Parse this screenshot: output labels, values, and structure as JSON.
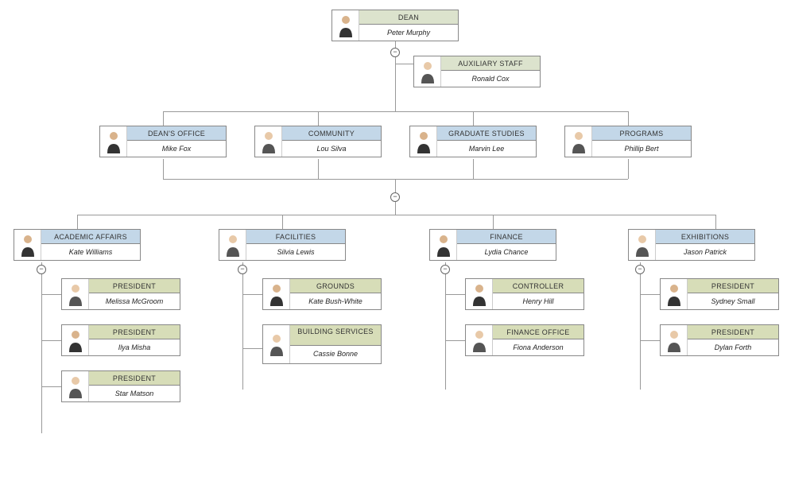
{
  "org": {
    "dean": {
      "title": "DEAN",
      "name": "Peter Murphy"
    },
    "aux": {
      "title": "AUXILIARY STAFF",
      "name": "Ronald Cox"
    },
    "deans_office": {
      "title": "DEAN'S OFFICE",
      "name": "Mike Fox"
    },
    "community": {
      "title": "COMMUNITY",
      "name": "Lou Silva"
    },
    "grad_studies": {
      "title": "GRADUATE STUDIES",
      "name": "Marvin Lee"
    },
    "programs": {
      "title": "PROGRAMS",
      "name": "Phillip Bert"
    },
    "academic": {
      "title": "ACADEMIC AFFAIRS",
      "name": "Kate Williams"
    },
    "facilities": {
      "title": "FACILITIES",
      "name": "Silvia Lewis"
    },
    "finance": {
      "title": "FINANCE",
      "name": "Lydia Chance"
    },
    "exhibitions": {
      "title": "EXHIBITIONS",
      "name": "Jason Patrick"
    },
    "president1": {
      "title": "PRESIDENT",
      "name": "Melissa McGroom"
    },
    "president2": {
      "title": "PRESIDENT",
      "name": "Ilya Misha"
    },
    "president3": {
      "title": "PRESIDENT",
      "name": "Star Matson"
    },
    "grounds": {
      "title": "GROUNDS",
      "name": "Kate Bush-White"
    },
    "building": {
      "title": "BUILDING SERVICES",
      "name": "Cassie Bonne"
    },
    "controller": {
      "title": "CONTROLLER",
      "name": "Henry Hill"
    },
    "finance_office": {
      "title": "FINANCE OFFICE",
      "name": "Fiona Anderson"
    },
    "president4": {
      "title": "PRESIDENT",
      "name": "Sydney Small"
    },
    "president5": {
      "title": "PRESIDENT",
      "name": "Dylan Forth"
    }
  },
  "toggle_symbol": "−",
  "colors": {
    "green": "#dce3cd",
    "blue": "#c3d7e8",
    "olive": "#d7ddb8",
    "border": "#888888"
  }
}
